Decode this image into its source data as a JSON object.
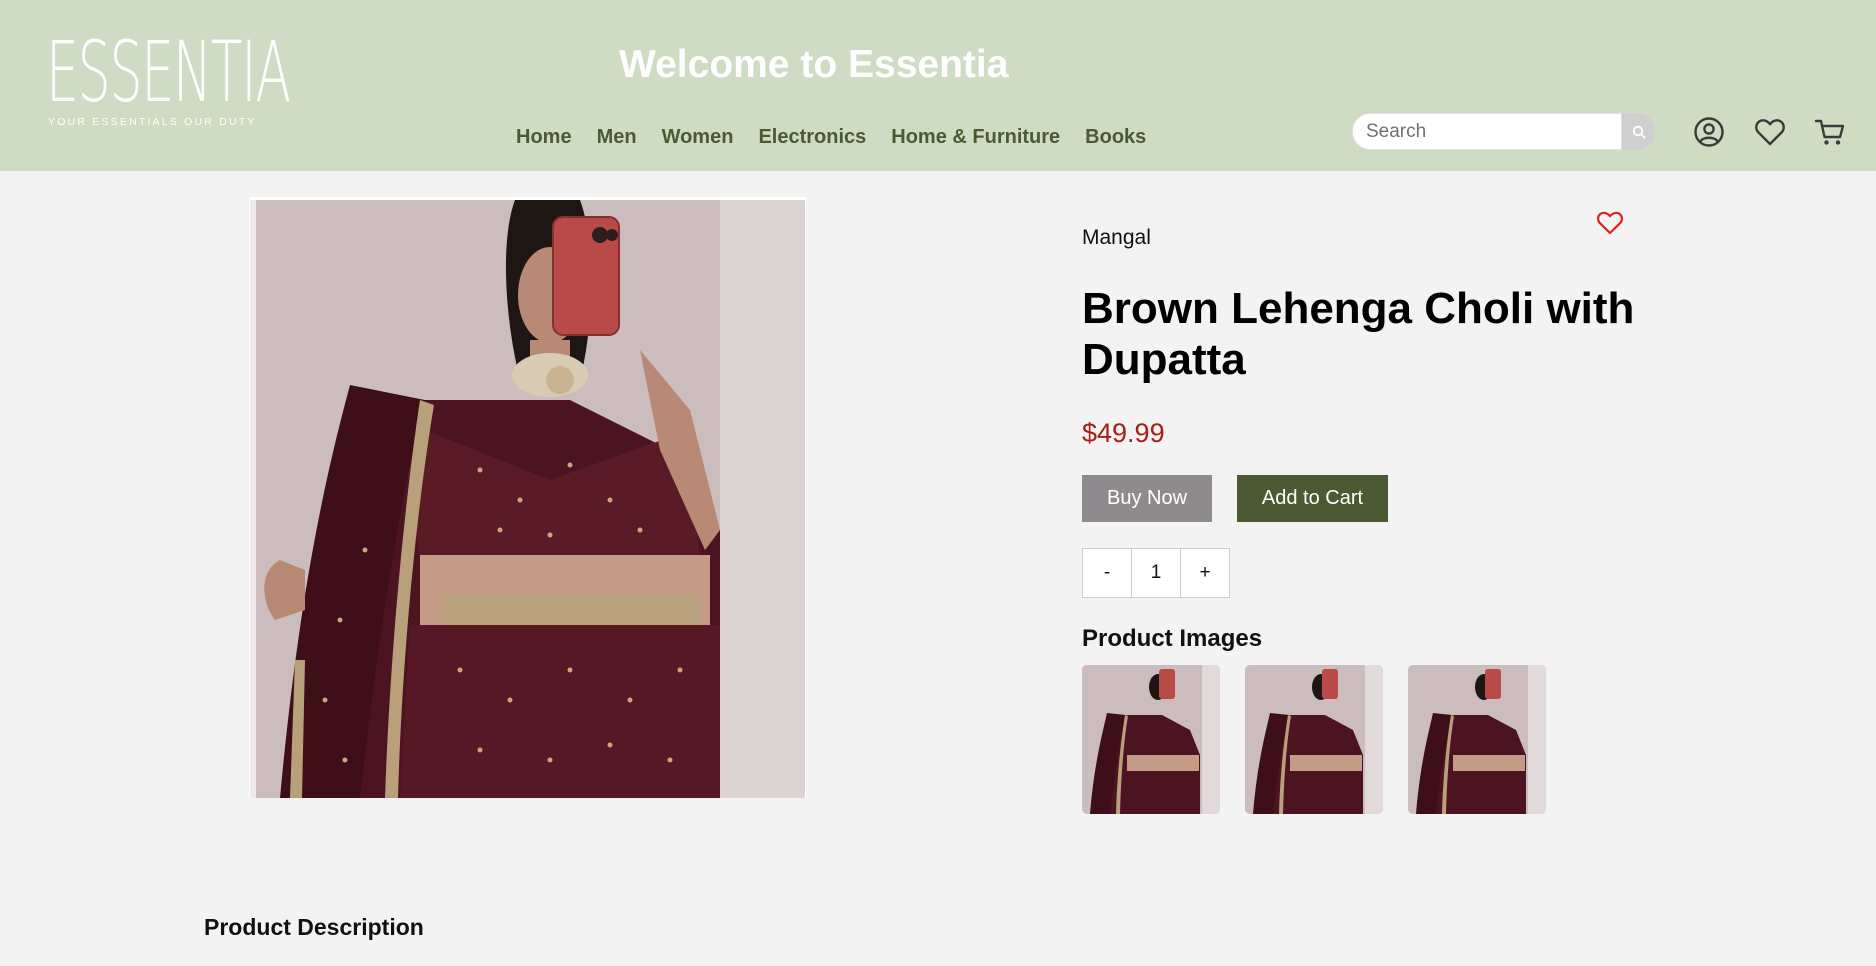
{
  "header": {
    "logo": "ESSENTIA",
    "logo_tagline": "YOUR ESSENTIALS OUR DUTY",
    "welcome": "Welcome to Essentia",
    "nav": [
      "Home",
      "Men",
      "Women",
      "Electronics",
      "Home & Furniture",
      "Books"
    ],
    "search_placeholder": "Search",
    "icons": [
      "search-icon",
      "account-icon",
      "wishlist-icon",
      "cart-icon"
    ],
    "bg_color": "#cfdcc4"
  },
  "product": {
    "brand": "Mangal",
    "title": "Brown Lehenga Choli with Dupatta",
    "price": "$49.99",
    "buy_now": "Buy Now",
    "add_to_cart": "Add to Cart",
    "qty_minus": "-",
    "qty_value": "1",
    "qty_plus": "+",
    "price_color": "#a52015",
    "cart_button_color": "#4c5a33"
  },
  "gallery": {
    "heading": "Product Images",
    "thumbnail_count": 3
  },
  "description": {
    "heading": "Product Description"
  }
}
